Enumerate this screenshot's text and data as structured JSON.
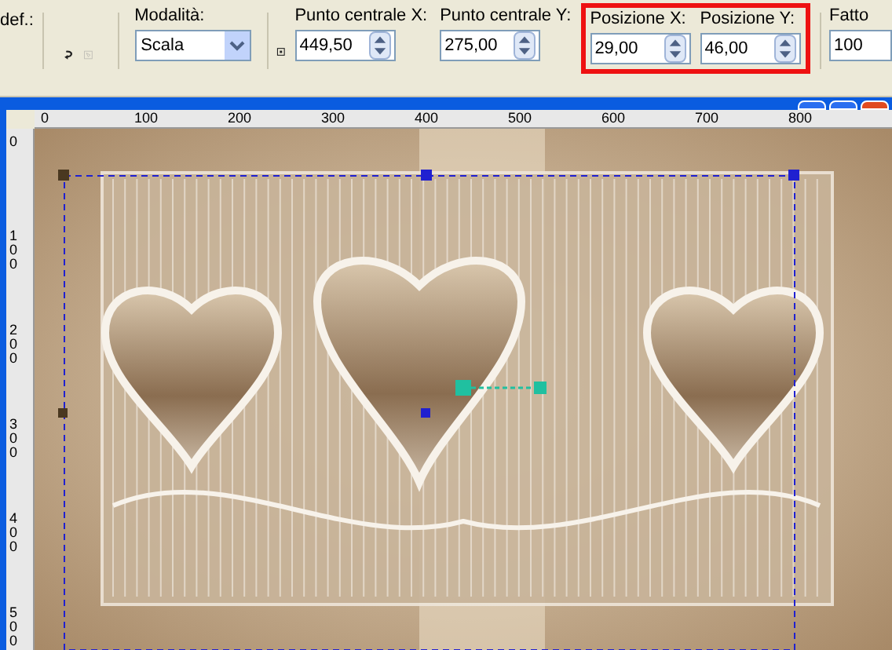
{
  "toolbar": {
    "preset_label": "def.:",
    "mode": {
      "label": "Modalità:",
      "value": "Scala"
    },
    "fields": [
      {
        "label": "Punto centrale X:",
        "value": "449,50",
        "highlighted": false
      },
      {
        "label": "Punto centrale Y:",
        "value": "275,00",
        "highlighted": false
      },
      {
        "label": "Posizione X:",
        "value": "29,00",
        "highlighted": true
      },
      {
        "label": "Posizione Y:",
        "value": "46,00",
        "highlighted": true
      },
      {
        "label": "Fatto",
        "value": "100",
        "highlighted": false
      }
    ]
  },
  "top_ruler": {
    "labels": [
      "0",
      "100",
      "200",
      "300",
      "400",
      "500",
      "600",
      "700",
      "800"
    ]
  },
  "left_ruler": {
    "labels": [
      "0",
      "100",
      "200",
      "300",
      "400",
      "500"
    ]
  }
}
